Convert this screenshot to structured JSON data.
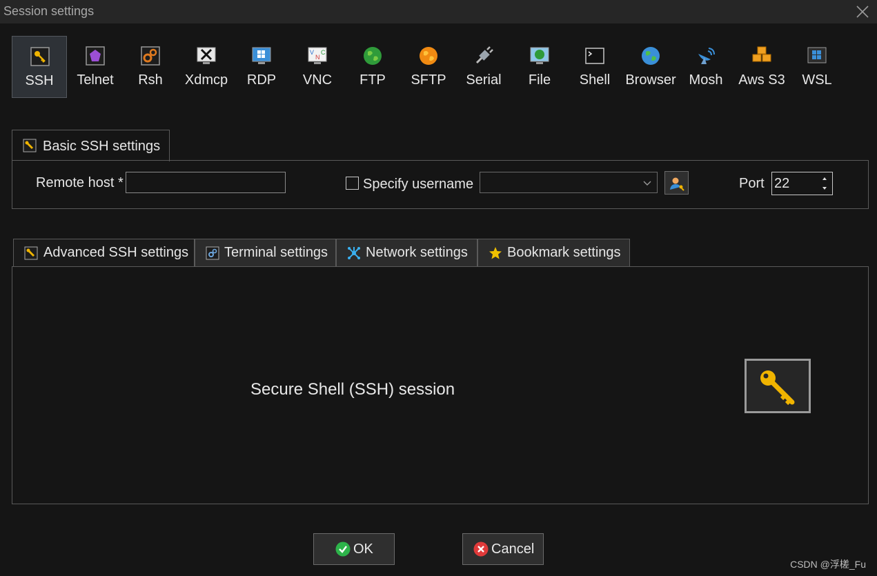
{
  "window": {
    "title": "Session settings"
  },
  "protocols": [
    {
      "label": "SSH",
      "icon": "ssh-key-icon",
      "selected": true
    },
    {
      "label": "Telnet",
      "icon": "telnet-gem-icon"
    },
    {
      "label": "Rsh",
      "icon": "rsh-gears-icon"
    },
    {
      "label": "Xdmcp",
      "icon": "xdmcp-x-icon"
    },
    {
      "label": "RDP",
      "icon": "rdp-windows-monitor-icon"
    },
    {
      "label": "VNC",
      "icon": "vnc-monitor-icon"
    },
    {
      "label": "FTP",
      "icon": "ftp-globe-icon"
    },
    {
      "label": "SFTP",
      "icon": "sftp-globe-icon"
    },
    {
      "label": "Serial",
      "icon": "serial-plug-icon"
    },
    {
      "label": "File",
      "icon": "file-globe-monitor-icon"
    },
    {
      "label": "Shell",
      "icon": "shell-terminal-icon"
    },
    {
      "label": "Browser",
      "icon": "browser-globe-icon"
    },
    {
      "label": "Mosh",
      "icon": "mosh-satellite-icon"
    },
    {
      "label": "Aws S3",
      "icon": "aws-s3-cubes-icon"
    },
    {
      "label": "WSL",
      "icon": "wsl-windows-icon"
    }
  ],
  "basic": {
    "tab_label": "Basic SSH settings",
    "remote_host_label": "Remote host *",
    "remote_host_value": "",
    "specify_username_label": "Specify username",
    "specify_username_checked": false,
    "username_value": "",
    "port_label": "Port",
    "port_value": "22"
  },
  "tabs": [
    {
      "label": "Advanced SSH settings",
      "icon": "wrench-icon"
    },
    {
      "label": "Terminal settings",
      "icon": "terminal-gears-icon"
    },
    {
      "label": "Network settings",
      "icon": "network-icon"
    },
    {
      "label": "Bookmark settings",
      "icon": "star-icon"
    }
  ],
  "content": {
    "description": "Secure Shell (SSH) session"
  },
  "buttons": {
    "ok": "OK",
    "cancel": "Cancel"
  },
  "colors": {
    "ok_green": "#2db34a",
    "cancel_red": "#e03a3a",
    "key_gold": "#f0b400"
  },
  "watermark": "CSDN @浮槎_Fu"
}
